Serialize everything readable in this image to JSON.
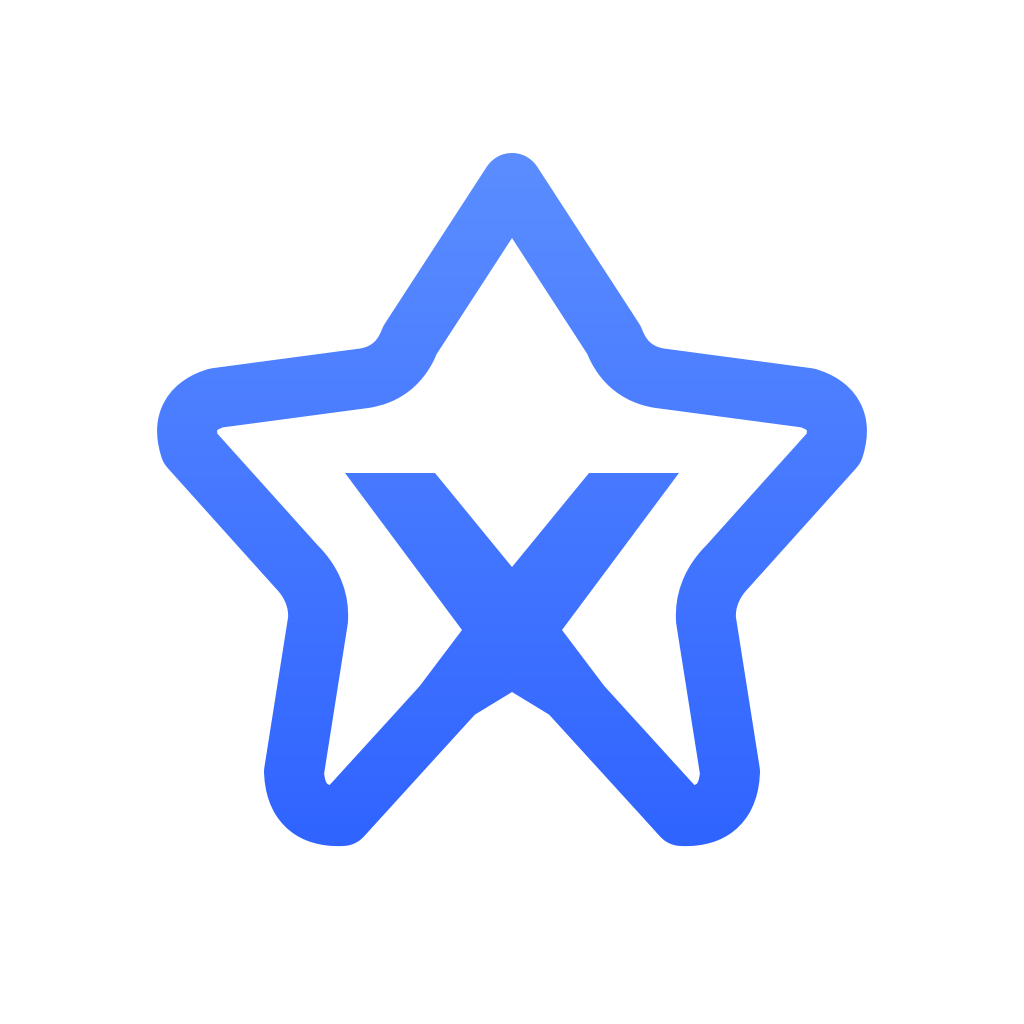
{
  "logo": {
    "icon": "star-x-logo-icon",
    "colors": {
      "gradient_top": "#5B8DFF",
      "gradient_bottom": "#2F63FF",
      "background": "#FFFFFF"
    }
  }
}
